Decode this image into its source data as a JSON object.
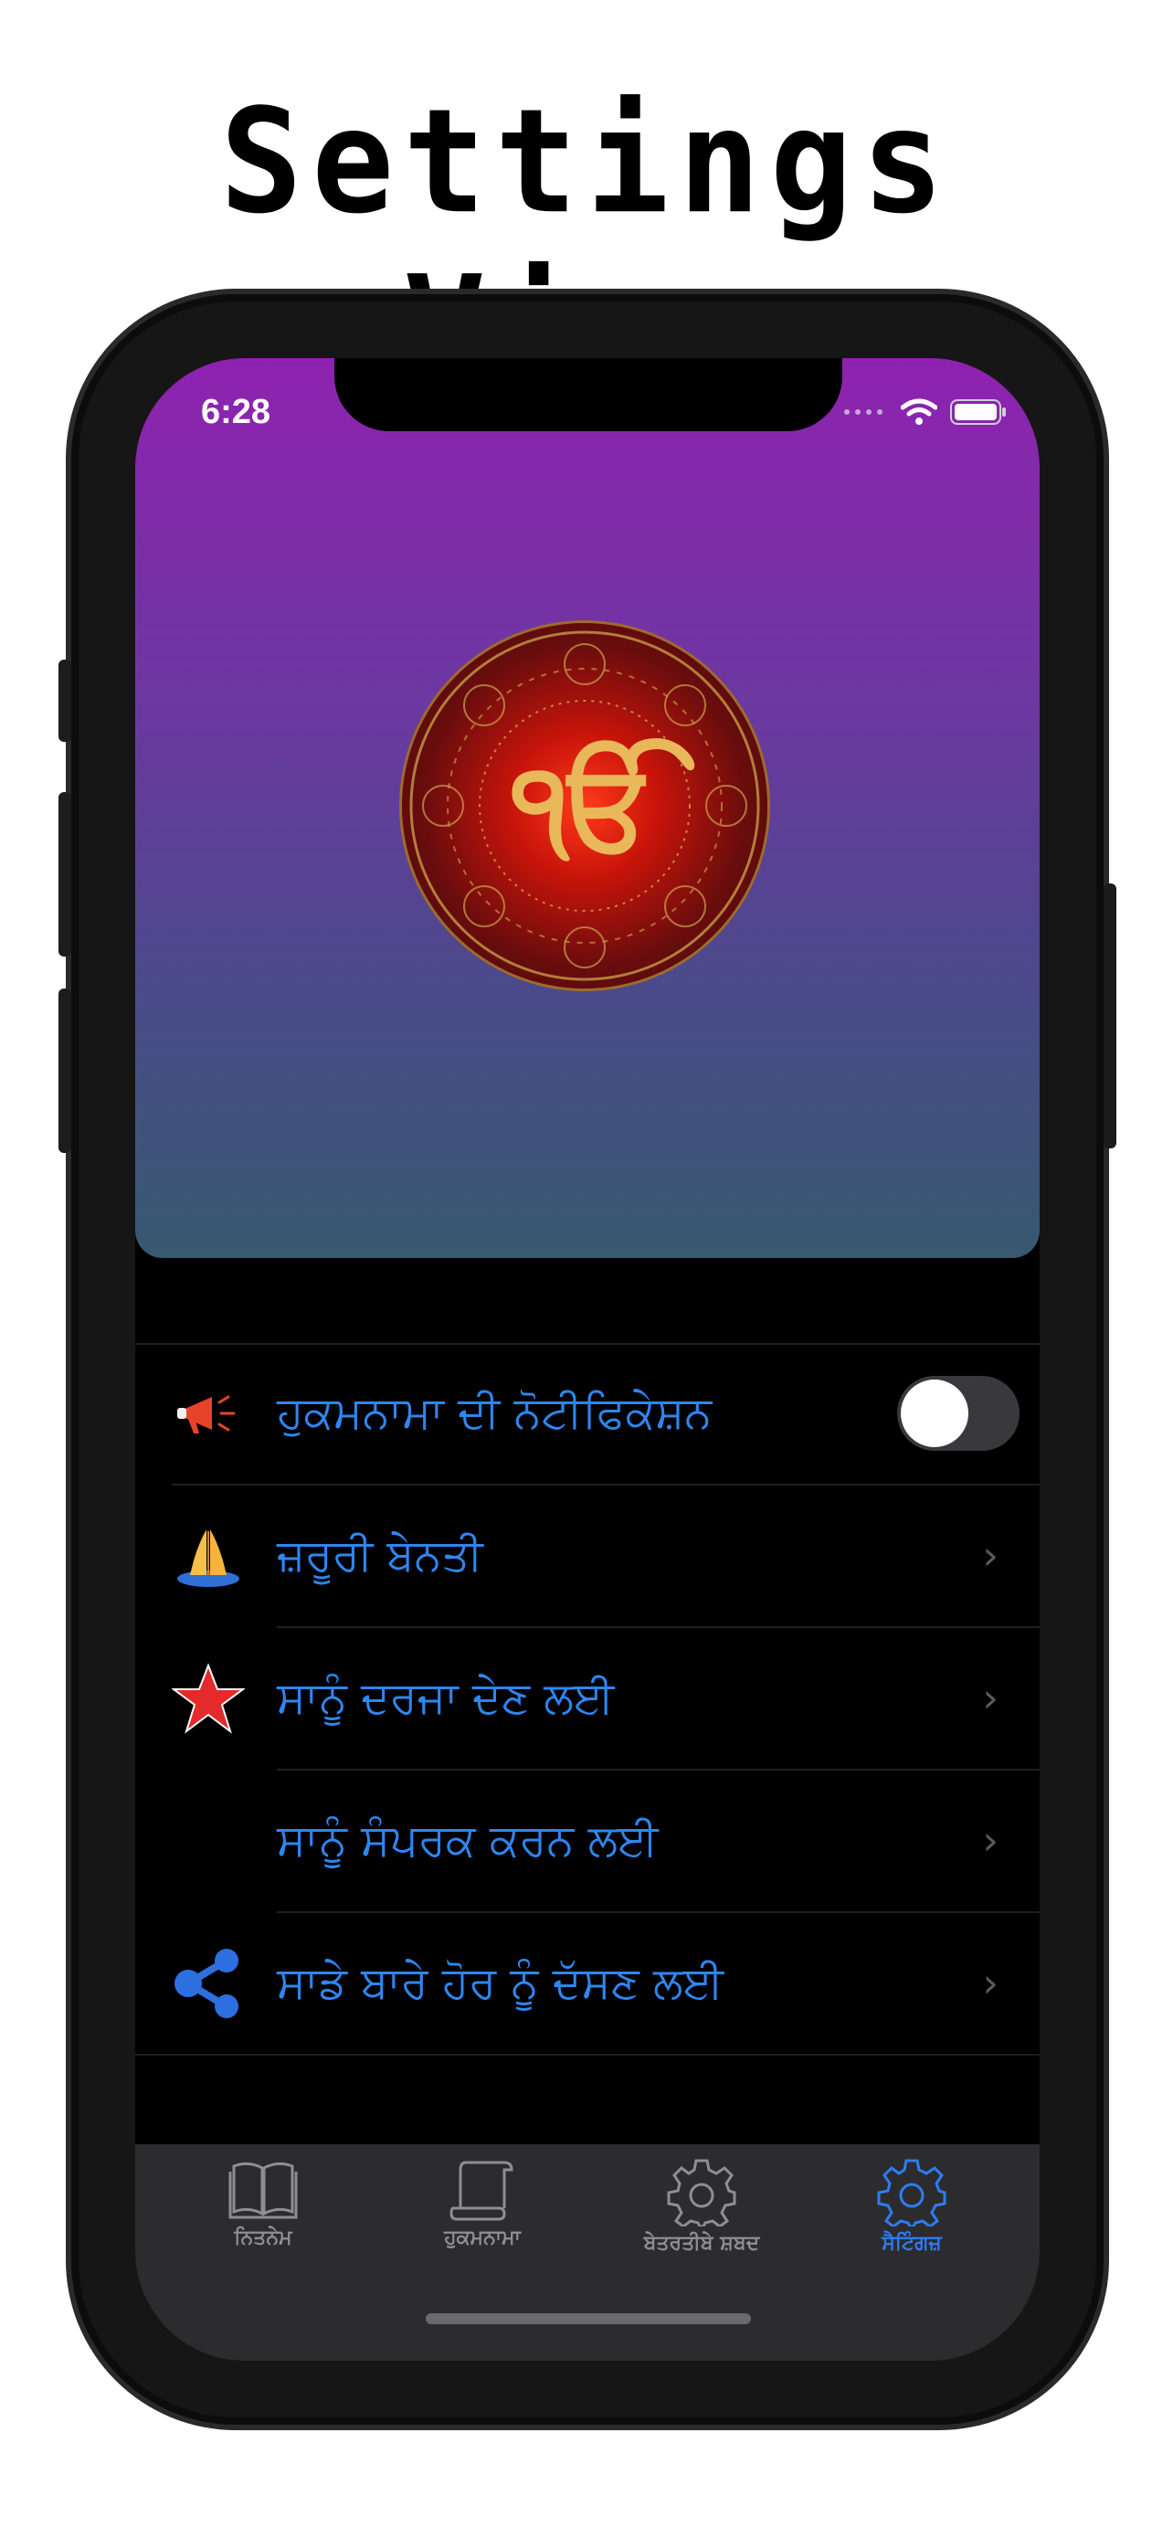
{
  "headline": "Settings View",
  "status": {
    "time": "6:28"
  },
  "hero": {
    "logo_text": "ੴ"
  },
  "settings": {
    "items": [
      {
        "label": "ਹੁਕਮਨਾਮਾ ਦੀ ਨੋਟੀਫਿਕੇਸ਼ਨ",
        "icon": "megaphone-icon",
        "control": "toggle",
        "toggle_on": false
      },
      {
        "label": "ਜ਼ਰੂਰੀ ਬੇਨਤੀ",
        "icon": "praying-hands-icon",
        "control": "chevron"
      },
      {
        "label": "ਸਾਨੂੰ ਦਰਜਾ ਦੇਣ ਲਈ",
        "icon": "star-icon",
        "control": "chevron"
      },
      {
        "label": "ਸਾਨੂੰ ਸੰਪਰਕ ਕਰਨ ਲਈ",
        "icon": "",
        "control": "chevron"
      },
      {
        "label": "ਸਾਡੇ ਬਾਰੇ ਹੋਰ ਨੂੰ ਦੱਸਣ ਲਈ",
        "icon": "share-icon",
        "control": "chevron"
      }
    ],
    "chevron": "›"
  },
  "tabs": [
    {
      "label": "ਨਿਤਨੇਮ",
      "icon": "book-icon",
      "active": false
    },
    {
      "label": "ਹੁਕਮਨਾਮਾ",
      "icon": "scroll-icon",
      "active": false
    },
    {
      "label": "ਬੇਤਰਤੀਬੇ ਸ਼ਬਦ",
      "icon": "gear-icon",
      "active": false
    },
    {
      "label": "ਸੈਟਿੰਗਜ਼",
      "icon": "gear-icon",
      "active": true
    }
  ],
  "colors": {
    "accent": "#2e7cf6",
    "hero_top": "#8f22b0",
    "hero_bottom": "#37596f",
    "tabbar_bg": "#2c2c2e"
  }
}
